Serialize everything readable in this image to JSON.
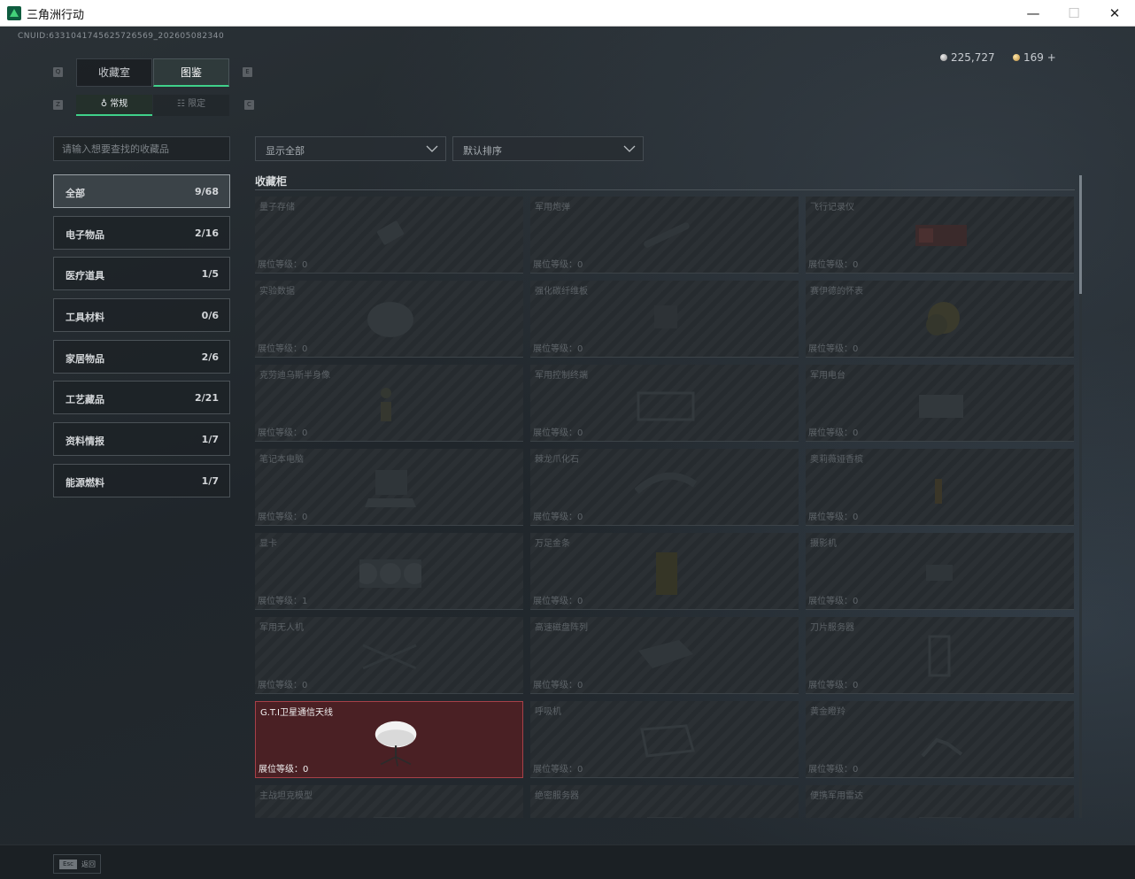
{
  "window": {
    "title": "三角洲行动",
    "minimize": "—",
    "maximize": "☐",
    "close": "✕"
  },
  "uid": "CNUID:6331041745625726569_202605082340",
  "currency": {
    "silver": "225,727",
    "gold": "169 +"
  },
  "main_tabs": [
    {
      "label": "收藏室",
      "active": false
    },
    {
      "label": "图鉴",
      "active": true
    }
  ],
  "sub_tabs": [
    {
      "label": "常规",
      "active": true
    },
    {
      "label": "限定",
      "active": false
    }
  ],
  "search": {
    "placeholder": "请输入想要查找的收藏品"
  },
  "filter_dropdown": {
    "value": "显示全部"
  },
  "sort_dropdown": {
    "value": "默认排序"
  },
  "categories": [
    {
      "label": "全部",
      "count": "9/68",
      "active": true
    },
    {
      "label": "电子物品",
      "count": "2/16"
    },
    {
      "label": "医疗道具",
      "count": "1/5"
    },
    {
      "label": "工具材料",
      "count": "0/6"
    },
    {
      "label": "家居物品",
      "count": "2/6"
    },
    {
      "label": "工艺藏品",
      "count": "2/21"
    },
    {
      "label": "资料情报",
      "count": "1/7"
    },
    {
      "label": "能源燃料",
      "count": "1/7"
    }
  ],
  "section_title": "收藏柜",
  "level_prefix": "展位等级：",
  "items": [
    {
      "name": "量子存储",
      "level": "0"
    },
    {
      "name": "军用炮弹",
      "level": "0"
    },
    {
      "name": "飞行记录仪",
      "level": "0"
    },
    {
      "name": "实验数据",
      "level": "0"
    },
    {
      "name": "强化碳纤维板",
      "level": "0"
    },
    {
      "name": "赛伊德的怀表",
      "level": "0"
    },
    {
      "name": "克劳迪乌斯半身像",
      "level": "0"
    },
    {
      "name": "军用控制终端",
      "level": "0"
    },
    {
      "name": "军用电台",
      "level": "0"
    },
    {
      "name": "笔记本电脑",
      "level": "0"
    },
    {
      "name": "棘龙爪化石",
      "level": "0"
    },
    {
      "name": "奥莉薇娅香槟",
      "level": "0"
    },
    {
      "name": "显卡",
      "level": "1"
    },
    {
      "name": "万足金条",
      "level": "0"
    },
    {
      "name": "摄影机",
      "level": "0"
    },
    {
      "name": "军用无人机",
      "level": "0"
    },
    {
      "name": "高速磁盘阵列",
      "level": "0"
    },
    {
      "name": "刀片服务器",
      "level": "0"
    },
    {
      "name": "G.T.I卫星通信天线",
      "level": "0",
      "highlight": true
    },
    {
      "name": "呼吸机",
      "level": "0"
    },
    {
      "name": "黄金瞪羚",
      "level": "0"
    },
    {
      "name": "主战坦克模型",
      "level": ""
    },
    {
      "name": "绝密服务器",
      "level": ""
    },
    {
      "name": "便携军用雷达",
      "level": ""
    }
  ],
  "footer": {
    "esc_key": "Esc",
    "back_label": "返回"
  }
}
